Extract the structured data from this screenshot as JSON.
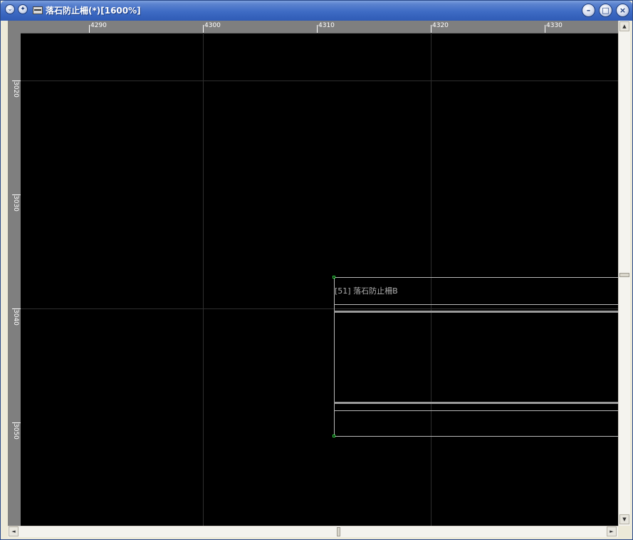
{
  "window": {
    "title": "落石防止柵(*)[1600%]",
    "controls": {
      "minimize": "–",
      "restore": "□",
      "close": "×"
    }
  },
  "ruler": {
    "horizontal": [
      "4290",
      "4300",
      "4310",
      "4320",
      "4330"
    ],
    "vertical": [
      "3020",
      "3030",
      "3040",
      "3050"
    ]
  },
  "drawing": {
    "object_label": "[51] 落石防止柵B"
  },
  "scrollbar": {
    "up": "▲",
    "down": "▼",
    "left": "◄",
    "right": "►"
  },
  "colors": {
    "canvas": "#000000",
    "ruler": "#7f7f7f",
    "handle": "#2ecc40",
    "titlebar": "#3e6bc4"
  }
}
